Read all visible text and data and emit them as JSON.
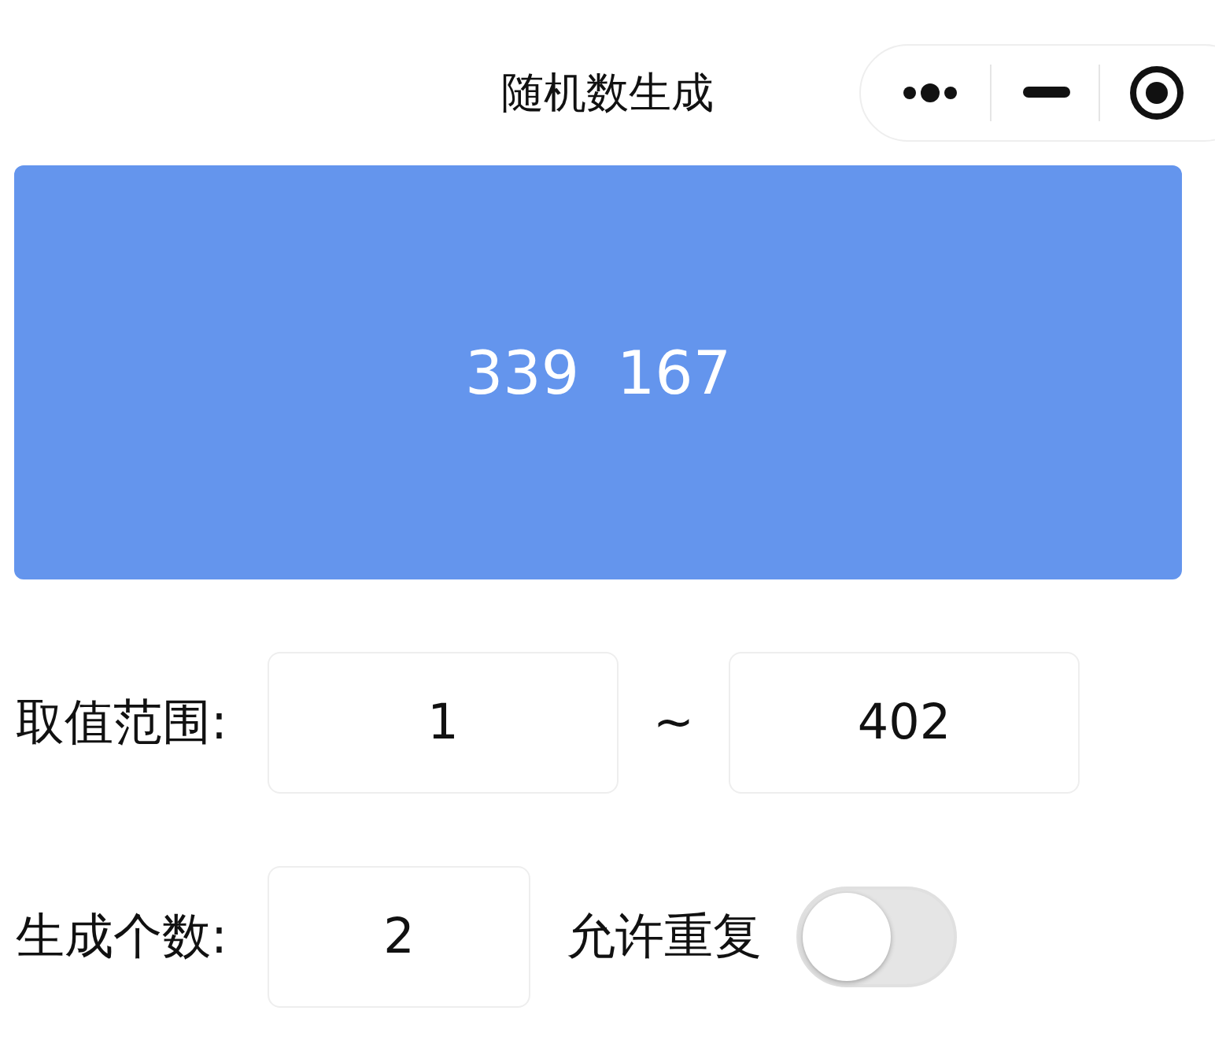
{
  "window": {
    "title": "随机数生成"
  },
  "results": [
    "339",
    "167"
  ],
  "range": {
    "label": "取值范围:",
    "min": "1",
    "separator": "~",
    "max": "402"
  },
  "count": {
    "label": "生成个数:",
    "value": "2"
  },
  "allow_repeat": {
    "label": "允许重复",
    "on": false
  }
}
